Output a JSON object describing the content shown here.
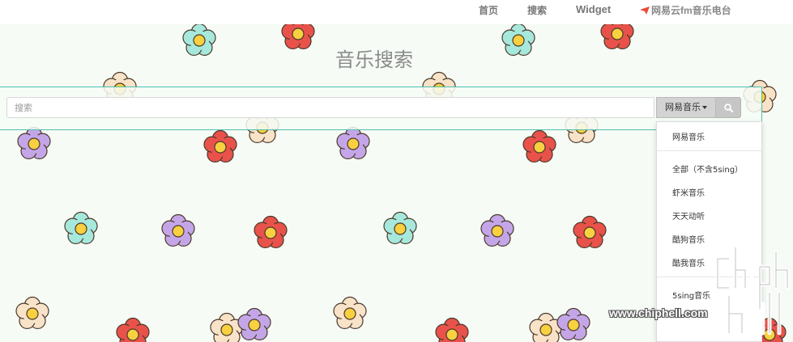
{
  "nav": {
    "home": "首页",
    "search": "搜索",
    "widget": "Widget",
    "fm": "网易云fm音乐电台"
  },
  "page": {
    "title": "音乐搜索"
  },
  "search": {
    "placeholder": "搜索",
    "selected_source": "网易音乐"
  },
  "dropdown": {
    "items": [
      "网易音乐",
      "全部（不含5sing）",
      "虾米音乐",
      "天天动听",
      "酷狗音乐",
      "酷我音乐",
      "5sing音乐"
    ]
  },
  "watermark": {
    "text": "chiphell",
    "url": "www.chiphell.com"
  },
  "colors": {
    "accent": "#4fc0b0",
    "fm_icon": "#e84a3c",
    "flower_red": "#e8524a",
    "flower_cyan": "#a6e8dc",
    "flower_purple": "#c4a6e8",
    "flower_cream": "#f8e2c8",
    "flower_center": "#f8d040"
  }
}
